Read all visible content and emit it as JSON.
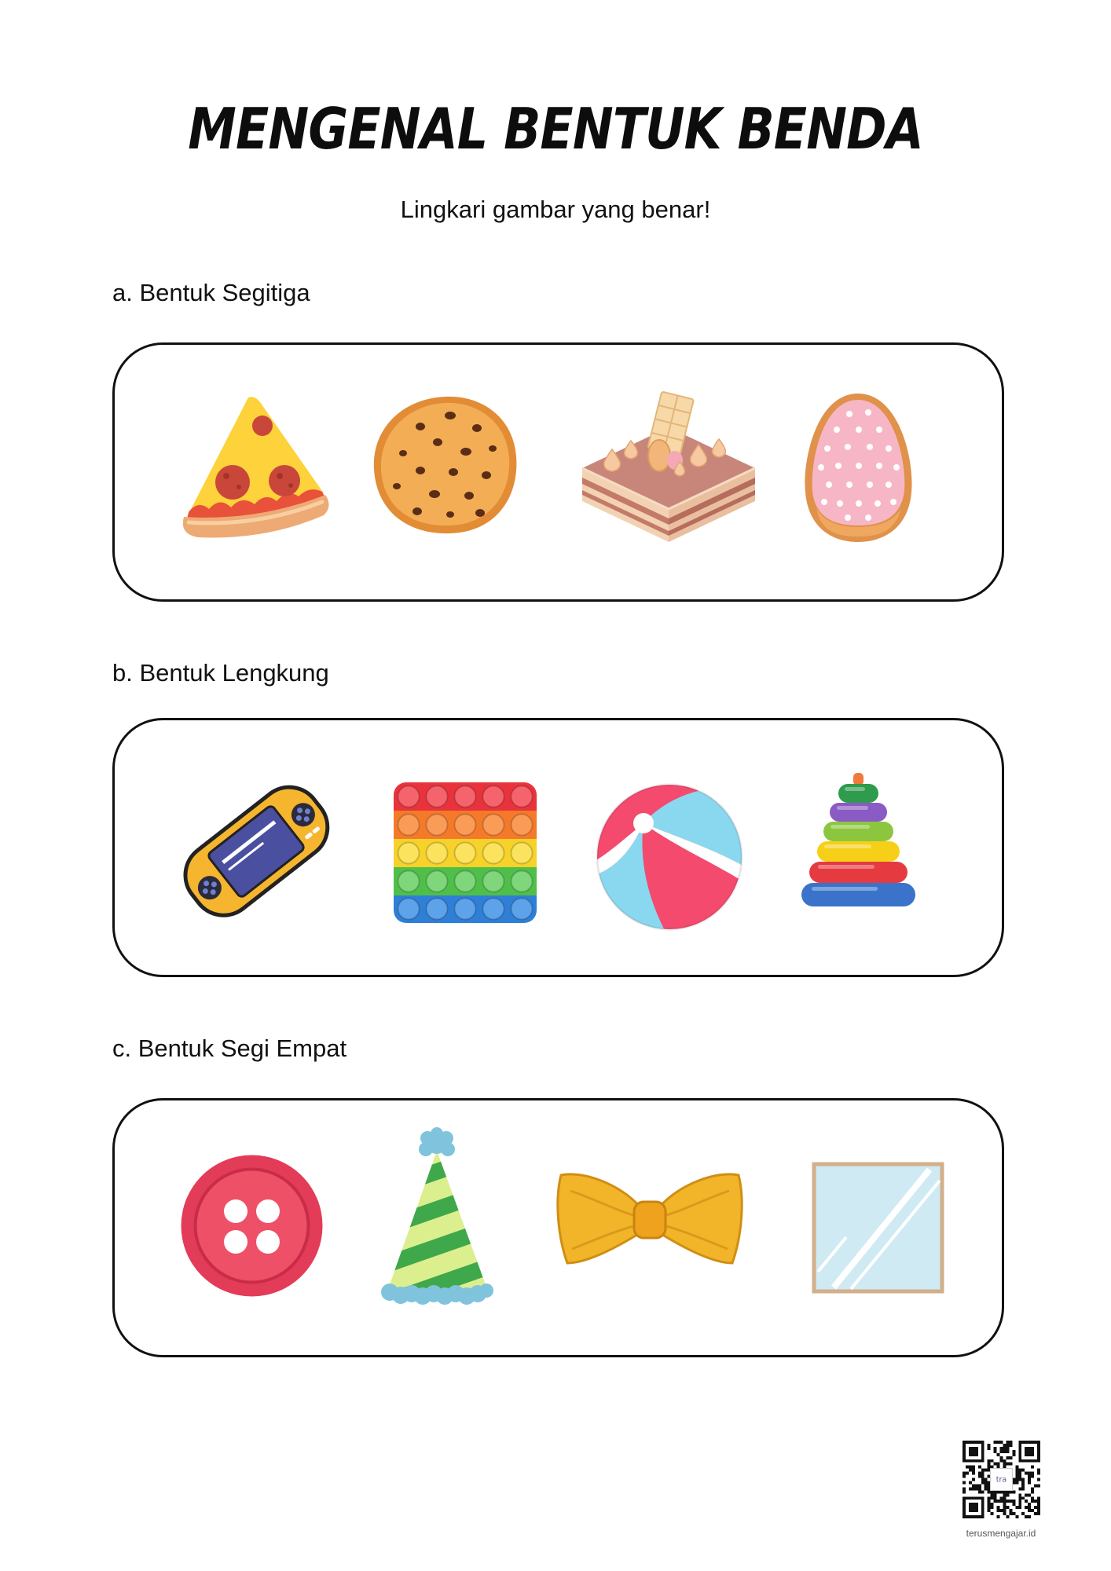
{
  "title": "MENGENAL BENTUK BENDA",
  "instruction": "Lingkari gambar yang benar!",
  "sections": [
    {
      "label": "a. Bentuk Segitiga",
      "icons": [
        "pizza-slice-icon",
        "cookie-icon",
        "layer-cake-icon",
        "egg-cookie-icon"
      ]
    },
    {
      "label": "b. Bentuk Lengkung",
      "icons": [
        "handheld-game-console-icon",
        "pop-it-toy-icon",
        "beach-ball-icon",
        "ring-stacker-toy-icon"
      ]
    },
    {
      "label": "c. Bentuk Segi Empat",
      "icons": [
        "sewing-button-icon",
        "party-hat-icon",
        "bow-tie-icon",
        "mirror-icon"
      ]
    }
  ],
  "footer": {
    "qr_logo_text": "tra",
    "website": "terusmengajar.id"
  },
  "colors": {
    "text": "#111111",
    "box_border": "#111111",
    "background": "#ffffff"
  }
}
